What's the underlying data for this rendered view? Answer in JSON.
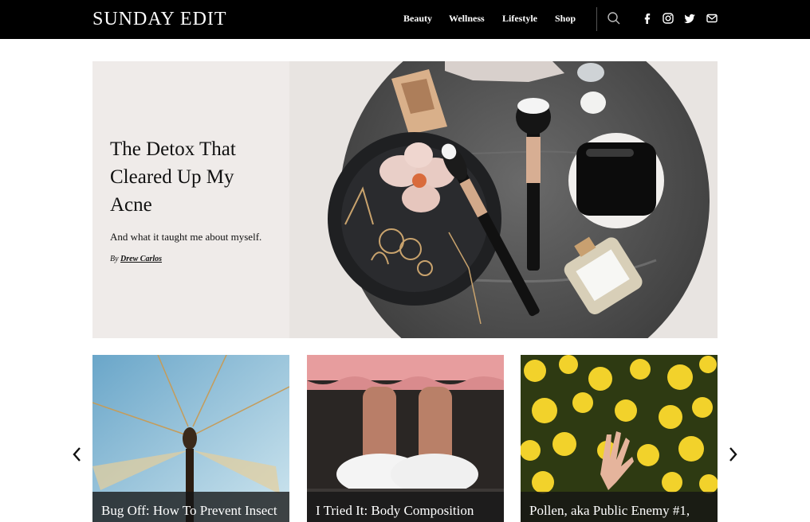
{
  "site": {
    "logo": "SUNDAY EDIT"
  },
  "nav": {
    "items": [
      "Beauty",
      "Wellness",
      "Lifestyle",
      "Shop"
    ]
  },
  "header_icons": [
    "search-icon",
    "facebook-icon",
    "instagram-icon",
    "twitter-icon",
    "email-icon"
  ],
  "hero": {
    "title": "The Detox That Cleared Up My Acne",
    "subtitle": "And what it taught me about myself.",
    "byline_prefix": "By",
    "author": "Drew Carlos"
  },
  "cards": [
    {
      "title": "Bug Off: How To Prevent Insect"
    },
    {
      "title": "I Tried It: Body Composition"
    },
    {
      "title": "Pollen, aka Public Enemy #1,"
    }
  ],
  "carousel": {
    "prev_icon": "chevron-left-icon",
    "next_icon": "chevron-right-icon"
  },
  "colors": {
    "header_bg": "#000000",
    "hero_text_bg": "#efebe9",
    "caption_bg": "#141414"
  }
}
